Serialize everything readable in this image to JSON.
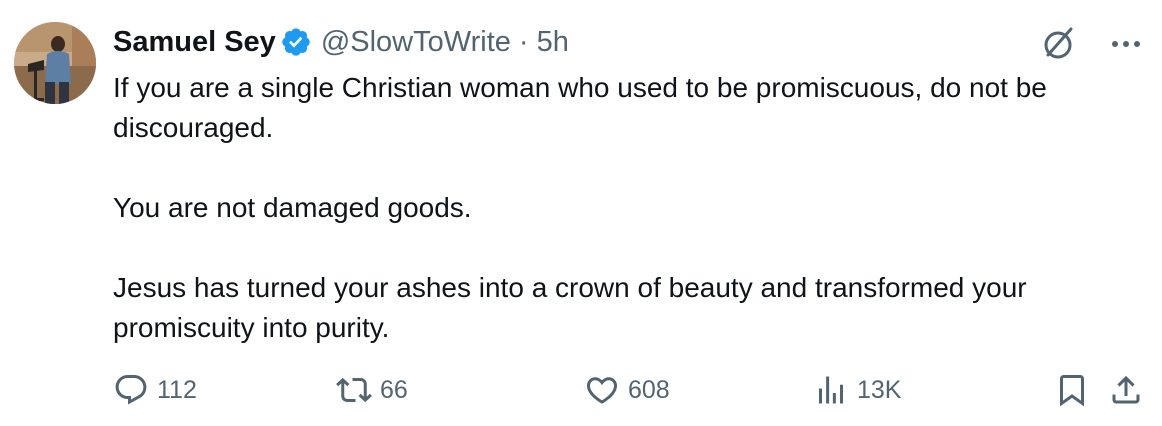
{
  "author": {
    "name": "Samuel Sey",
    "handle": "@SlowToWrite",
    "separator": "·",
    "time": "5h",
    "verified": true
  },
  "tweet": {
    "paragraphs": [
      "If you are a single Christian woman who used to be promiscuous, do not be discouraged.",
      "You are not damaged goods.",
      "Jesus has turned your ashes into a crown of beauty and transformed your promiscuity into purity."
    ]
  },
  "metrics": {
    "replies": "112",
    "reposts": "66",
    "likes": "608",
    "views": "13K"
  },
  "icons": {
    "verified": "verified-badge-icon",
    "grok": "grok-icon",
    "more": "more-icon",
    "reply": "reply-icon",
    "repost": "repost-icon",
    "like": "heart-icon",
    "views": "views-icon",
    "bookmark": "bookmark-icon",
    "share": "share-icon"
  },
  "colors": {
    "text": "#0f1419",
    "secondary": "#536471",
    "verified": "#1d9bf0",
    "background": "#ffffff"
  }
}
